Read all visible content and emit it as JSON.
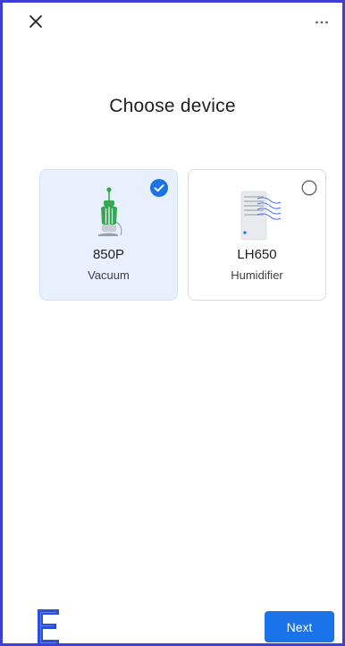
{
  "header": {
    "close_icon": "close-icon",
    "more_icon": "more-horizontal-icon"
  },
  "page": {
    "title": "Choose device"
  },
  "devices": [
    {
      "model": "850P",
      "kind": "Vacuum",
      "selected": true,
      "icon": "vacuum-icon"
    },
    {
      "model": "LH650",
      "kind": "Humidifier",
      "selected": false,
      "icon": "humidifier-icon"
    }
  ],
  "footer": {
    "next_label": "Next",
    "logo": "brand-logo"
  },
  "colors": {
    "accent": "#1a73e8",
    "selected_card_bg": "#e8f0fe",
    "frame_border": "#3f3fd6",
    "vacuum_green": "#34a853"
  }
}
